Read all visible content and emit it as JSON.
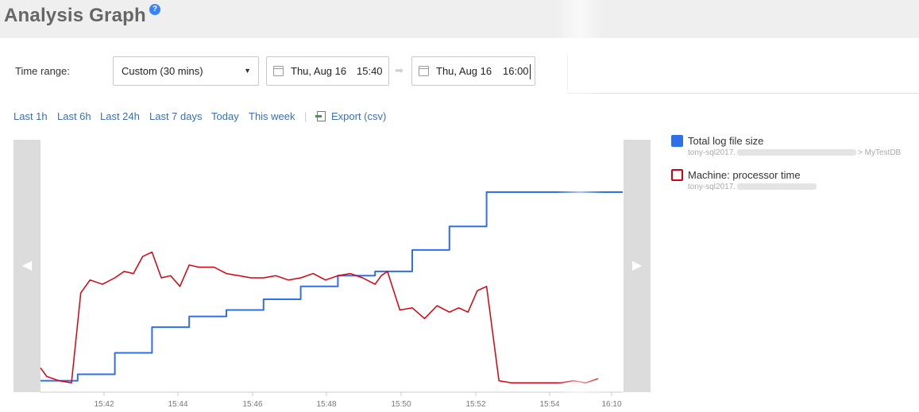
{
  "header": {
    "title": "Analysis Graph",
    "help_icon": "help-icon"
  },
  "controls": {
    "time_range_label": "Time range:",
    "preset": {
      "selected": "Custom (30 mins)"
    },
    "start": {
      "date": "Thu, Aug 16",
      "time": "15:40"
    },
    "end": {
      "date": "Thu, Aug 16",
      "time": "16:00"
    },
    "range_arrow_icon": "arrow-right-icon",
    "calendar_icon": "calendar-icon"
  },
  "quick_links": [
    "Last 1h",
    "Last 6h",
    "Last 24h",
    "Last 7 days",
    "Today",
    "This week"
  ],
  "export": {
    "label": "Export (csv)",
    "icon": "export-icon"
  },
  "legend": [
    {
      "name": "Total log file size",
      "source_prefix": "tony-sql2017.",
      "source_suffix": "> MyTestDB",
      "color": "#2f6fe8",
      "style": "filled"
    },
    {
      "name": "Machine: processor time",
      "source_prefix": "tony-sql2017.",
      "source_suffix": "",
      "color": "#d9000d",
      "style": "outline"
    }
  ],
  "chart_data": {
    "type": "line",
    "x_tick_labels": [
      "15:42",
      "15:44",
      "15:46",
      "15:48",
      "15:50",
      "15:52",
      "15:54",
      "16:10"
    ],
    "series": [
      {
        "name": "Total log file size",
        "color": "#2f6fe8",
        "step": true,
        "x": [
          "15:40:00",
          "15:41:00",
          "15:42:00",
          "15:43:00",
          "15:44:00",
          "15:45:00",
          "15:46:00",
          "15:47:00",
          "15:48:00",
          "15:49:00",
          "15:50:00",
          "15:51:00",
          "15:52:00",
          "15:55:00"
        ],
        "values": [
          2,
          5,
          15,
          27,
          32,
          35,
          40,
          46,
          51,
          53,
          63,
          74,
          90,
          90
        ]
      },
      {
        "name": "Machine: processor time",
        "color": "#d9000d",
        "x": [
          "15:40:00",
          "15:40:10",
          "15:40:30",
          "15:40:50",
          "15:41:05",
          "15:41:20",
          "15:41:40",
          "15:42:00",
          "15:42:15",
          "15:42:30",
          "15:42:45",
          "15:43:00",
          "15:43:15",
          "15:43:30",
          "15:43:45",
          "15:44:00",
          "15:44:15",
          "15:44:40",
          "15:45:00",
          "15:45:20",
          "15:45:40",
          "15:46:00",
          "15:46:20",
          "15:46:40",
          "15:47:00",
          "15:47:20",
          "15:47:40",
          "15:48:00",
          "15:48:20",
          "15:48:40",
          "15:49:00",
          "15:49:10",
          "15:49:20",
          "15:49:40",
          "15:50:00",
          "15:50:20",
          "15:50:40",
          "15:51:00",
          "15:51:15",
          "15:51:30",
          "15:51:45",
          "15:52:00",
          "15:52:20",
          "15:52:40",
          "15:53:00",
          "15:53:20",
          "15:53:40",
          "15:54:00",
          "15:54:20",
          "15:54:40",
          "15:55:00"
        ],
        "values": [
          8,
          4,
          2,
          1,
          43,
          49,
          47,
          50,
          53,
          52,
          60,
          62,
          50,
          51,
          46,
          56,
          55,
          55,
          52,
          51,
          50,
          50,
          51,
          49,
          50,
          52,
          49,
          51,
          52,
          50,
          47,
          51,
          53,
          35,
          36,
          31,
          37,
          34,
          36,
          34,
          44,
          46,
          2,
          1,
          1,
          1,
          1,
          1,
          2,
          1,
          3
        ]
      }
    ],
    "grid": false
  }
}
